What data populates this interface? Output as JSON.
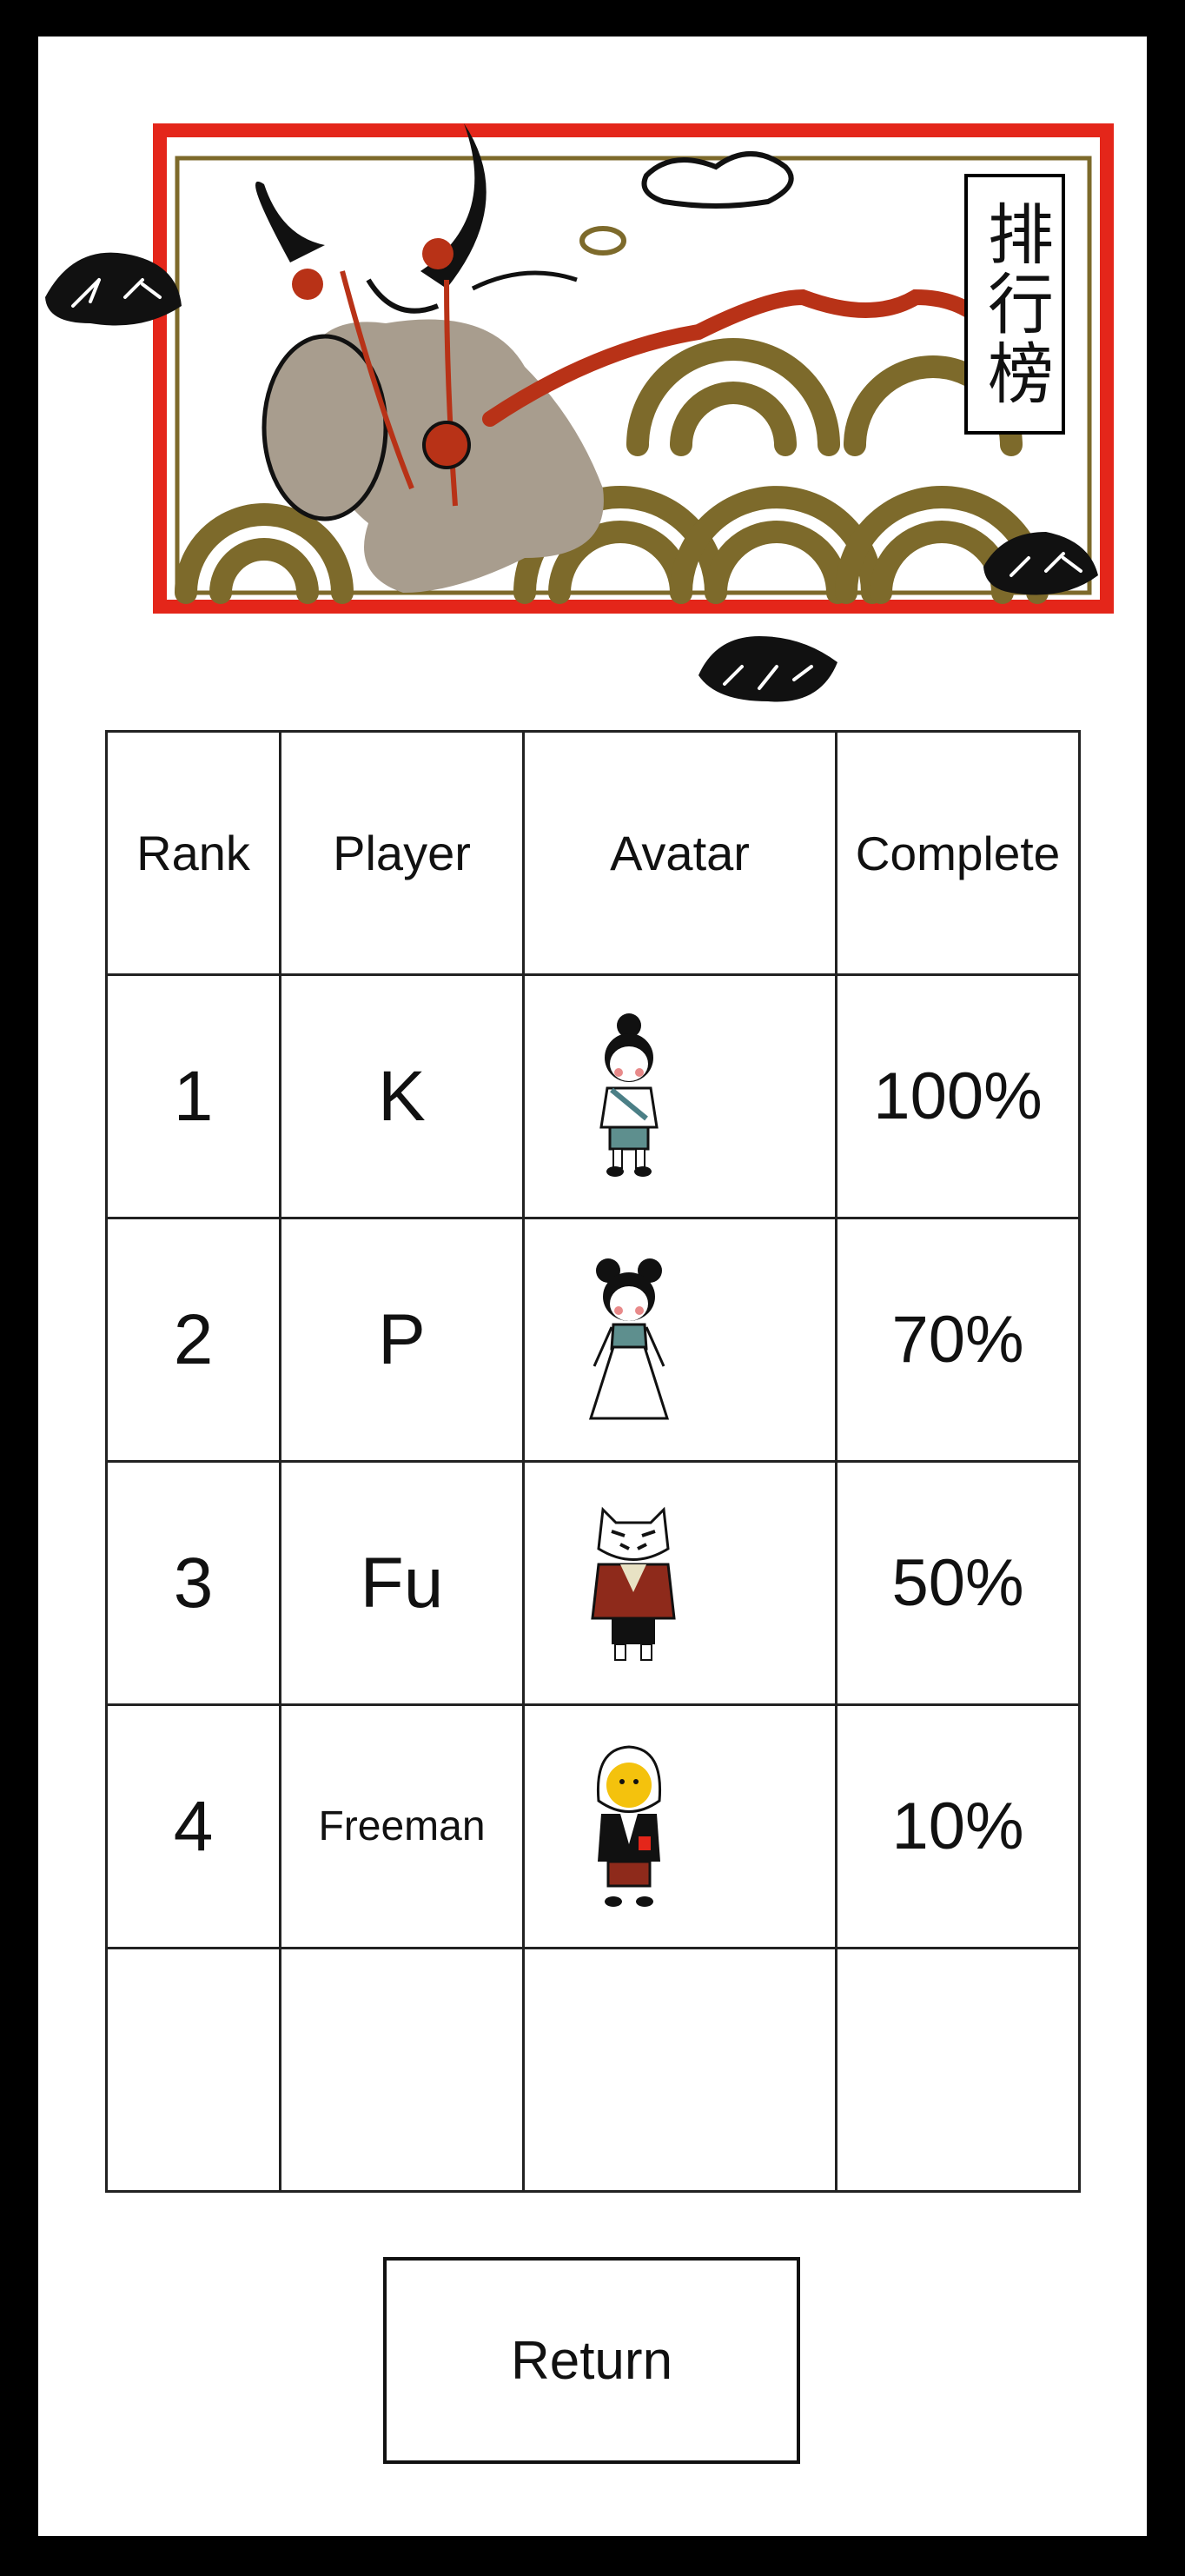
{
  "banner": {
    "title": "排行榜",
    "title_icon": "leaderboard-banner-art"
  },
  "leaderboard": {
    "headers": {
      "rank": "Rank",
      "player": "Player",
      "avatar": "Avatar",
      "complete": "Complete"
    },
    "rows": [
      {
        "rank": "1",
        "player": "K",
        "avatar": "girl-with-bun-avatar",
        "complete": "100%"
      },
      {
        "rank": "2",
        "player": "P",
        "avatar": "girl-in-white-dress-avatar",
        "complete": "70%"
      },
      {
        "rank": "3",
        "player": "Fu",
        "avatar": "tiger-mask-avatar",
        "complete": "50%"
      },
      {
        "rank": "4",
        "player": "Freeman",
        "avatar": "hooded-yellow-face-avatar",
        "complete": "10%"
      }
    ]
  },
  "actions": {
    "return_label": "Return"
  },
  "colors": {
    "frame_red": "#e4261a",
    "olive": "#7d6a2b",
    "taupe": "#a89d8e",
    "accent_red": "#b83217"
  }
}
